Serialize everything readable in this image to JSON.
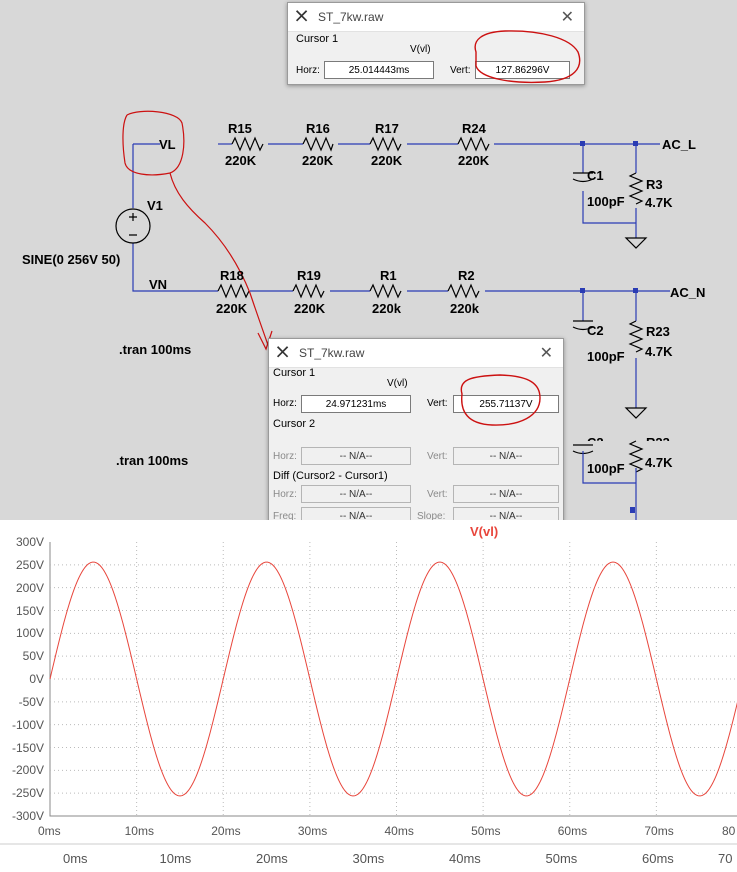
{
  "schematic": {
    "resistors_top": [
      {
        "name": "R15",
        "value": "220K"
      },
      {
        "name": "R16",
        "value": "220K"
      },
      {
        "name": "R17",
        "value": "220K"
      },
      {
        "name": "R24",
        "value": "220K"
      }
    ],
    "resistors_bottom": [
      {
        "name": "R18",
        "value": "220K"
      },
      {
        "name": "R19",
        "value": "220K"
      },
      {
        "name": "R1",
        "value": "220k"
      },
      {
        "name": "R2",
        "value": "220k"
      }
    ],
    "net_vl": "VL",
    "net_vn": "VN",
    "net_acl": "AC_L",
    "net_acn": "AC_N",
    "source_name": "V1",
    "source_value": "SINE(0 256V 50)",
    "c1_name": "C1",
    "c1_value": "100pF",
    "r3_name": "R3",
    "r3_value": "4.7K",
    "c2_name": "C2",
    "c2_value": "100pF",
    "r23_name": "R23",
    "r23_value": "4.7K",
    "c2b_name": "C2",
    "c2b_value": "100pF",
    "r23b_name": "R23",
    "r23b_value": "4.7K",
    "tran1": ".tran 100ms",
    "tran2": ".tran 100ms"
  },
  "dialog_top": {
    "title": "ST_7kw.raw",
    "cursor1_label": "Cursor 1",
    "signal": "V(vl)",
    "horz_label": "Horz:",
    "horz_value": "25.014443ms",
    "vert_label": "Vert:",
    "vert_value": "127.86296V"
  },
  "dialog_main": {
    "title": "ST_7kw.raw",
    "cursor1_label": "Cursor 1",
    "signal": "V(vl)",
    "horz_label": "Horz:",
    "horz_value": "24.971231ms",
    "vert_label": "Vert:",
    "vert_value": "255.71137V",
    "cursor2_label": "Cursor 2",
    "c2_horz_value": "-- N/A--",
    "c2_vert_value": "-- N/A--",
    "diff_label": "Diff (Cursor2 - Cursor1)",
    "diff_horz_value": "-- N/A--",
    "diff_vert_value": "-- N/A--",
    "freq_label": "Freq:",
    "freq_value": "-- N/A--",
    "slope_label": "Slope:",
    "slope_value": "-- N/A--"
  },
  "colors": {
    "trace": "#e8463c",
    "schematic_bg": "#d8d8d8",
    "wire": "#2a3cb4",
    "annotation": "#cc1111"
  },
  "chart_data": {
    "type": "line",
    "title": "V(vl)",
    "xlabel": "",
    "ylabel": "",
    "series": [
      {
        "name": "V(vl)",
        "amplitude": 256,
        "frequency_hz": 50,
        "offset": 0
      }
    ],
    "x_ticks": [
      "0ms",
      "10ms",
      "20ms",
      "30ms",
      "40ms",
      "50ms",
      "60ms",
      "70ms",
      "80"
    ],
    "x_ticks_lower": [
      "0ms",
      "10ms",
      "20ms",
      "30ms",
      "40ms",
      "50ms",
      "60ms",
      "70"
    ],
    "y_ticks": [
      "300V",
      "250V",
      "200V",
      "150V",
      "100V",
      "50V",
      "0V",
      "-50V",
      "-100V",
      "-150V",
      "-200V",
      "-250V",
      "-300V"
    ],
    "xlim": [
      0,
      80
    ],
    "ylim": [
      -300,
      300
    ],
    "grid": true
  }
}
